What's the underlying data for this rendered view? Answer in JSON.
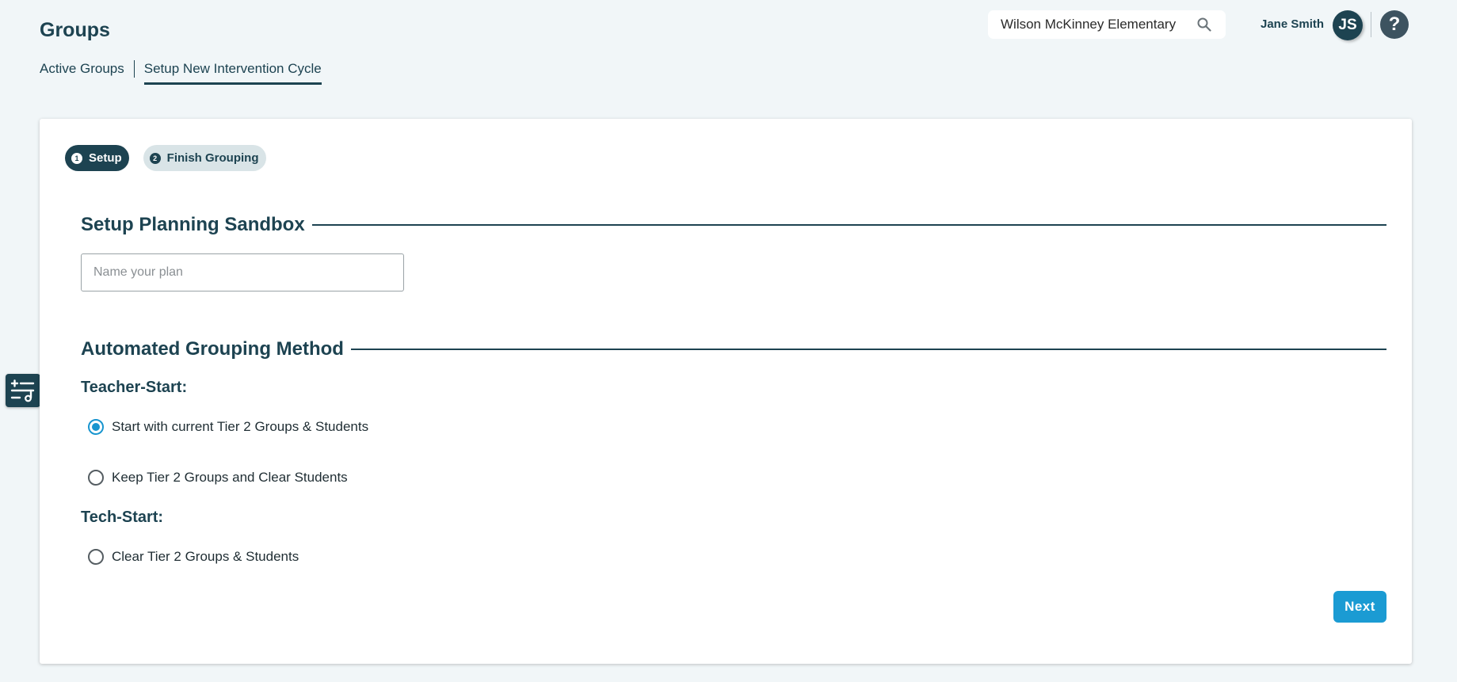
{
  "header": {
    "title": "Groups",
    "subnav": [
      "Active Groups",
      "Setup New Intervention Cycle"
    ],
    "school_search_value": "Wilson McKinney Elementary",
    "user_name": "Jane Smith",
    "avatar_initials": "JS",
    "help_label": "?"
  },
  "steps": [
    {
      "number": "1",
      "label": "Setup",
      "active": true
    },
    {
      "number": "2",
      "label": "Finish Grouping",
      "active": false
    }
  ],
  "sandbox": {
    "heading": "Setup Planning Sandbox",
    "plan_name_value": "",
    "plan_name_placeholder": "Name your plan"
  },
  "grouping": {
    "heading": "Automated Grouping Method",
    "teacher_start_label": "Teacher-Start:",
    "tech_start_label": "Tech-Start:",
    "options": [
      {
        "label": "Start with current Tier 2 Groups & Students",
        "checked": true
      },
      {
        "label": "Keep Tier 2 Groups and Clear Students",
        "checked": false
      },
      {
        "label": "Clear Tier 2 Groups & Students",
        "checked": false
      }
    ]
  },
  "actions": {
    "next_label": "Next"
  },
  "icons": {
    "search": "search-icon",
    "side_tool": "filter-music-icon"
  },
  "colors": {
    "primary": "#1d4351",
    "accent": "#1b9bd3",
    "background": "#f1f6f8"
  }
}
